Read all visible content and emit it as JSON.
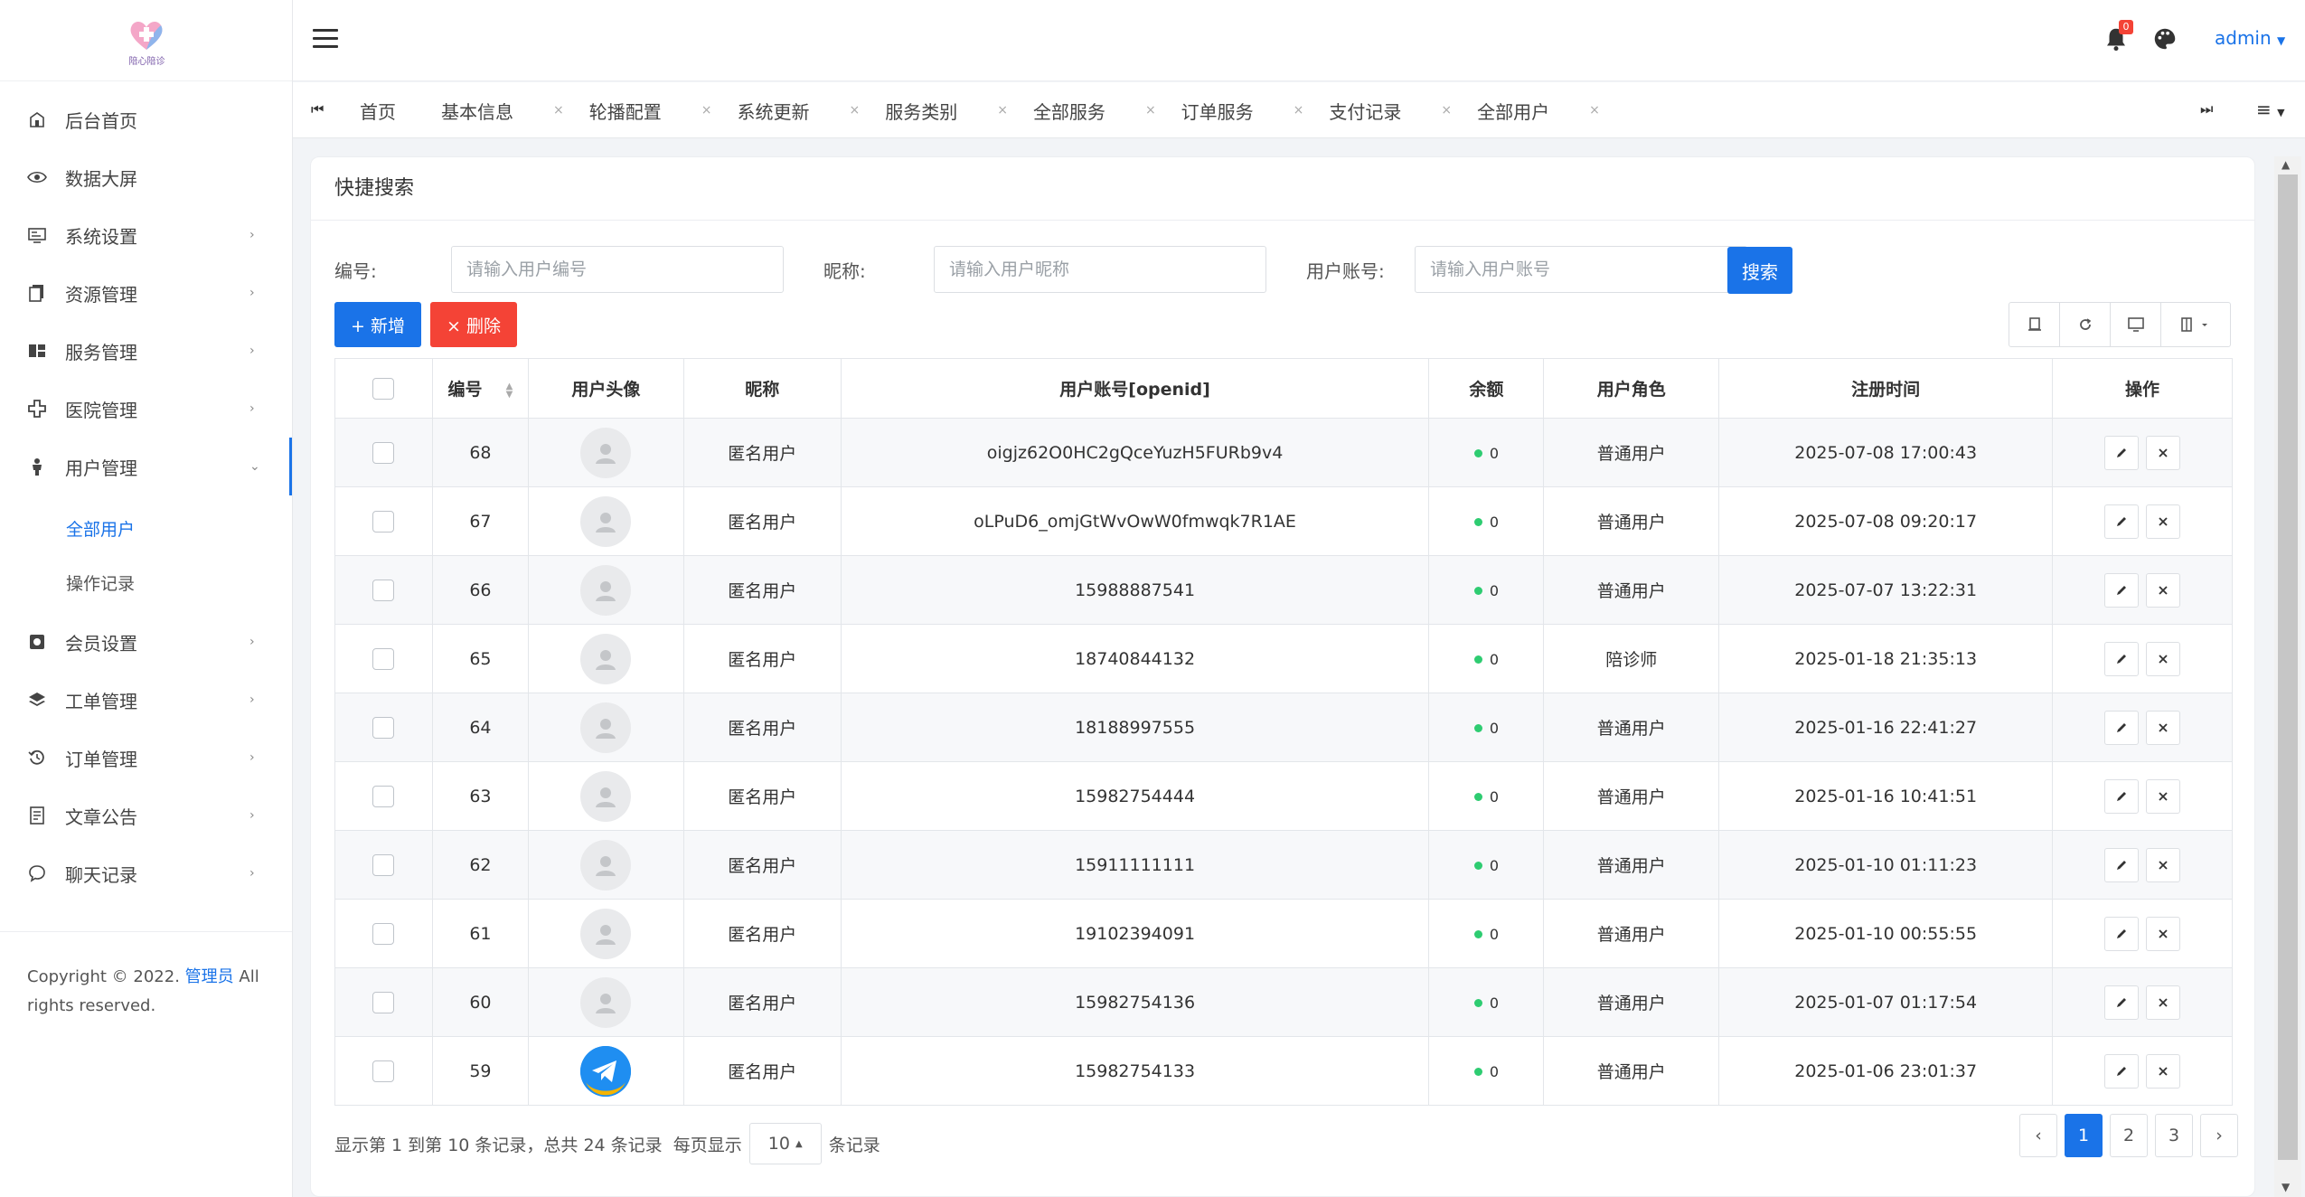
{
  "app": {
    "logo_text": "陪心陪诊",
    "user": "admin",
    "notification_count": "0"
  },
  "sidebar": {
    "items": [
      {
        "label": "后台首页",
        "icon": "home-icon"
      },
      {
        "label": "数据大屏",
        "icon": "eye-icon"
      },
      {
        "label": "系统设置",
        "icon": "settings-icon"
      },
      {
        "label": "资源管理",
        "icon": "file-icon"
      },
      {
        "label": "服务管理",
        "icon": "grid-icon"
      },
      {
        "label": "医院管理",
        "icon": "plus-icon"
      },
      {
        "label": "用户管理",
        "icon": "user-icon"
      },
      {
        "label": "会员设置",
        "icon": "member-icon"
      },
      {
        "label": "工单管理",
        "icon": "layers-icon"
      },
      {
        "label": "订单管理",
        "icon": "history-icon"
      },
      {
        "label": "文章公告",
        "icon": "article-icon"
      },
      {
        "label": "聊天记录",
        "icon": "chat-icon"
      }
    ],
    "sub_items": [
      "全部用户",
      "操作记录"
    ],
    "footer_prefix": "Copyright © 2022.",
    "footer_link": "管理员",
    "footer_suffix": "All rights reserved."
  },
  "tabs": [
    "首页",
    "基本信息",
    "轮播配置",
    "系统更新",
    "服务类别",
    "全部服务",
    "订单服务",
    "支付记录",
    "全部用户"
  ],
  "card": {
    "title": "快捷搜索",
    "search": {
      "id_label": "编号:",
      "id_placeholder": "请输入用户编号",
      "nick_label": "昵称:",
      "nick_placeholder": "请输入用户昵称",
      "account_label": "用户账号:",
      "account_placeholder": "请输入用户账号",
      "button": "搜索"
    },
    "add_label": "+ 新增",
    "delete_label": "× 删除"
  },
  "table": {
    "headers": [
      "编号",
      "用户头像",
      "昵称",
      "用户账号[openid]",
      "余额",
      "用户角色",
      "注册时间",
      "操作"
    ],
    "rows": [
      {
        "id": "68",
        "nick": "匿名用户",
        "account": "oigjz62O0HC2gQceYuzH5FURb9v4",
        "balance": "0",
        "role": "普通用户",
        "time": "2025-07-08 17:00:43"
      },
      {
        "id": "67",
        "nick": "匿名用户",
        "account": "oLPuD6_omjGtWvOwW0fmwqk7R1AE",
        "balance": "0",
        "role": "普通用户",
        "time": "2025-07-08 09:20:17"
      },
      {
        "id": "66",
        "nick": "匿名用户",
        "account": "15988887541",
        "balance": "0",
        "role": "普通用户",
        "time": "2025-07-07 13:22:31"
      },
      {
        "id": "65",
        "nick": "匿名用户",
        "account": "18740844132",
        "balance": "0",
        "role": "陪诊师",
        "time": "2025-01-18 21:35:13"
      },
      {
        "id": "64",
        "nick": "匿名用户",
        "account": "18188997555",
        "balance": "0",
        "role": "普通用户",
        "time": "2025-01-16 22:41:27"
      },
      {
        "id": "63",
        "nick": "匿名用户",
        "account": "15982754444",
        "balance": "0",
        "role": "普通用户",
        "time": "2025-01-16 10:41:51"
      },
      {
        "id": "62",
        "nick": "匿名用户",
        "account": "15911111111",
        "balance": "0",
        "role": "普通用户",
        "time": "2025-01-10 01:11:23"
      },
      {
        "id": "61",
        "nick": "匿名用户",
        "account": "19102394091",
        "balance": "0",
        "role": "普通用户",
        "time": "2025-01-10 00:55:55"
      },
      {
        "id": "60",
        "nick": "匿名用户",
        "account": "15982754136",
        "balance": "0",
        "role": "普通用户",
        "time": "2025-01-07 01:17:54"
      },
      {
        "id": "59",
        "nick": "匿名用户",
        "account": "15982754133",
        "balance": "0",
        "role": "普通用户",
        "time": "2025-01-06 23:01:37"
      }
    ]
  },
  "pagination": {
    "info_prefix": "显示第 1 到第 10 条记录，总共 24 条记录",
    "per_page_label": "每页显示",
    "per_page": "10",
    "suffix": "条记录",
    "prev": "‹",
    "pages": [
      "1",
      "2",
      "3"
    ],
    "next": "›"
  },
  "colors": {
    "primary": "#1a73e8",
    "danger": "#f44336",
    "balance_dot": "#2ecc71"
  }
}
